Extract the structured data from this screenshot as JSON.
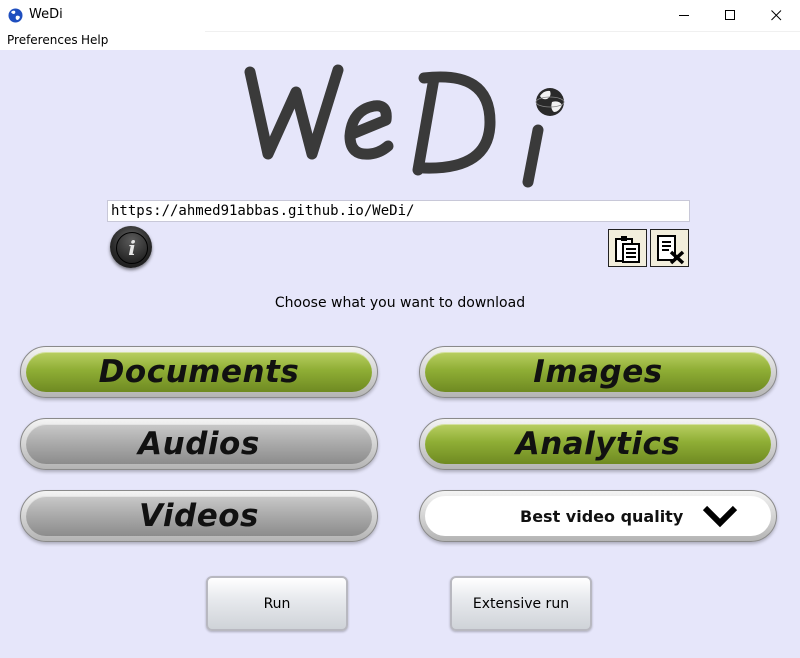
{
  "window": {
    "title": "WeDi",
    "controls": [
      "minimize-icon",
      "maximize-icon",
      "close-icon"
    ]
  },
  "menu": {
    "items": [
      "Preferences",
      "Help"
    ]
  },
  "logo": {
    "text": "WeDi",
    "icon": "globe-icon"
  },
  "url": {
    "value": "https://ahmed91abbas.github.io/WeDi/"
  },
  "tools": {
    "info_icon": "info-icon",
    "info_glyph": "i",
    "paste_icon": "clipboard-paste-icon",
    "clear_icon": "clear-document-icon"
  },
  "prompt": "Choose what you want to download",
  "options": {
    "documents": {
      "label": "Documents",
      "active": true
    },
    "images": {
      "label": "Images",
      "active": true
    },
    "audios": {
      "label": "Audios",
      "active": false
    },
    "analytics": {
      "label": "Analytics",
      "active": true
    },
    "videos": {
      "label": "Videos",
      "active": false
    }
  },
  "quality": {
    "selected": "Best video quality"
  },
  "actions": {
    "run": "Run",
    "extensive_run": "Extensive run"
  },
  "colors": {
    "background": "#e6e6fa",
    "active_green": "#8fae35",
    "inactive_gray": "#a9a9a9"
  }
}
